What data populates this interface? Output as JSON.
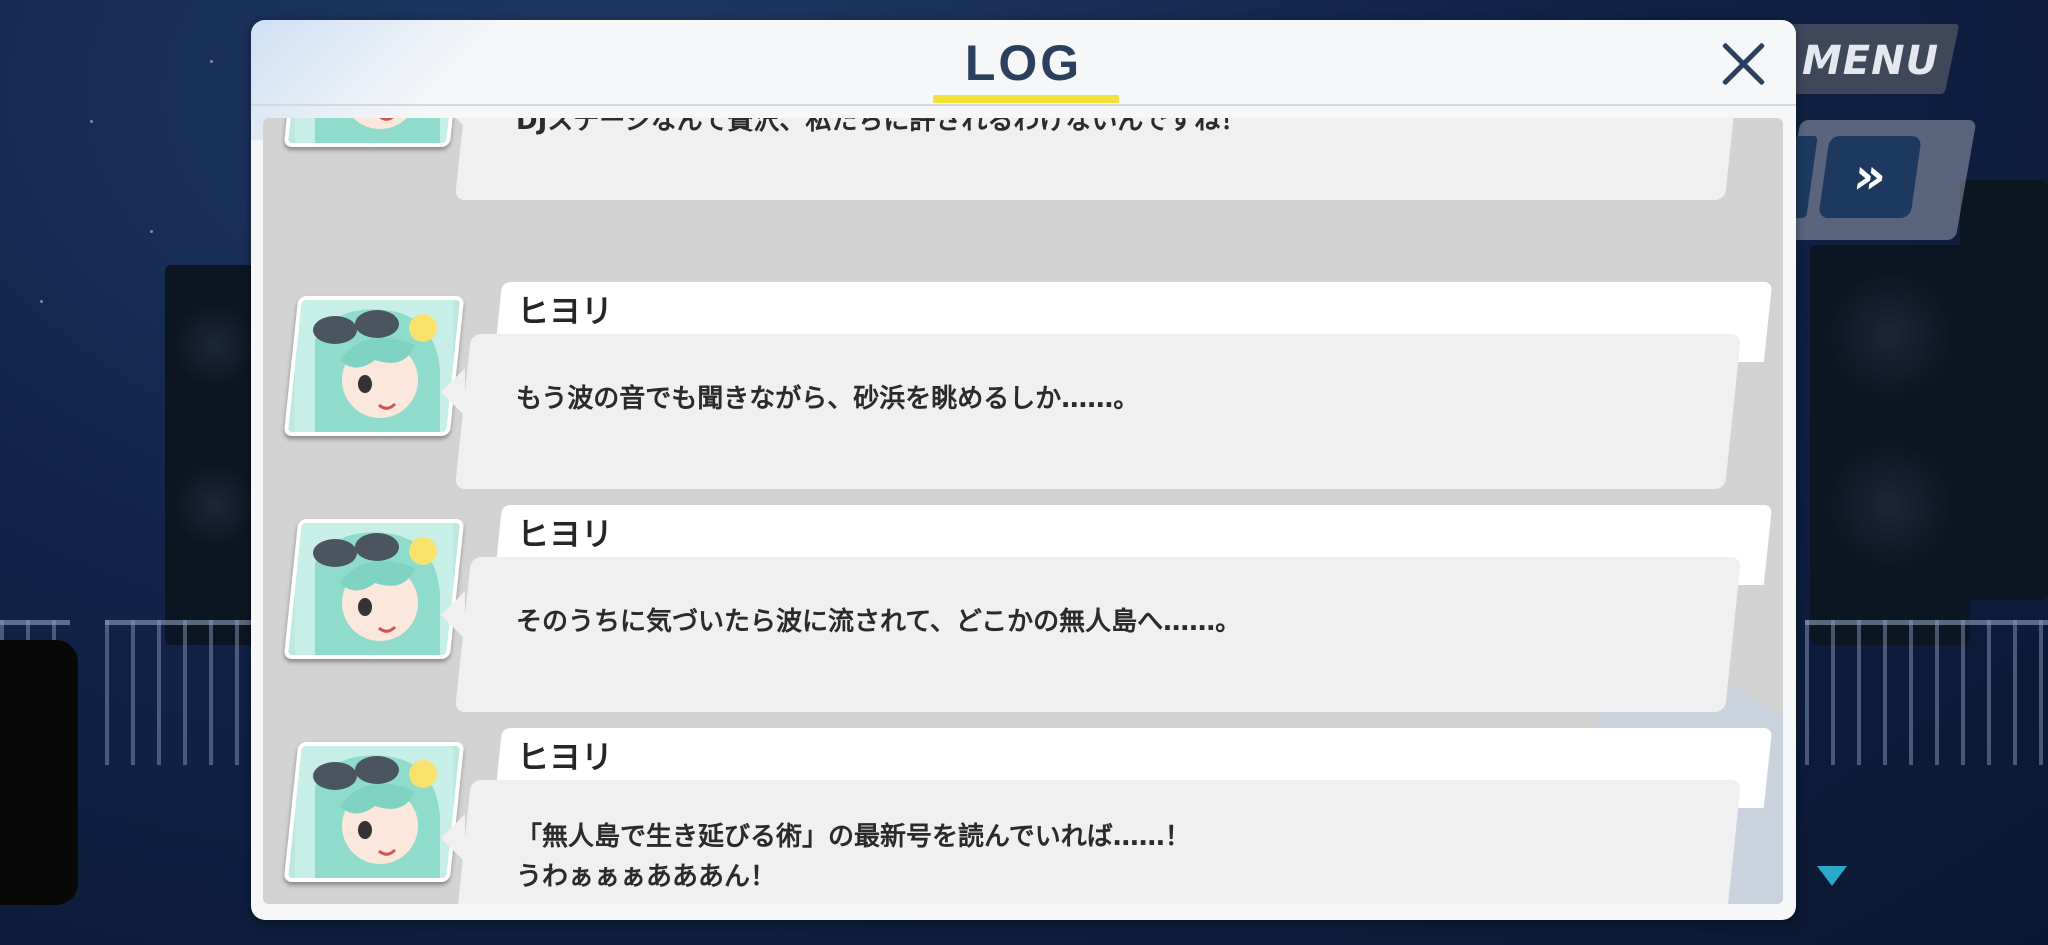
{
  "hud": {
    "menu_label": "MENU",
    "fast_forward_label": "»",
    "menu_icon": "menu-button",
    "fast_forward_icon": "fast-forward-icon",
    "scroll_icon": "scroll-down-triangle-icon"
  },
  "log_panel": {
    "title": "LOG",
    "close_icon": "close-icon",
    "accent_color": "#f3e23c",
    "title_color": "#2b3f5e"
  },
  "entries": [
    {
      "speaker": "",
      "lines": [
        "DJステージなんて贅沢、私たちに許されるわけないんですね！"
      ]
    },
    {
      "speaker": "ヒヨリ",
      "lines": [
        "もう波の音でも聞きながら、砂浜を眺めるしか……。"
      ]
    },
    {
      "speaker": "ヒヨリ",
      "lines": [
        "そのうちに気づいたら波に流されて、どこかの無人島へ……。"
      ]
    },
    {
      "speaker": "ヒヨリ",
      "lines": [
        "「無人島で生き延びる術」の最新号を読んでいれば……！",
        "うわぁぁぁあああん！"
      ]
    }
  ]
}
